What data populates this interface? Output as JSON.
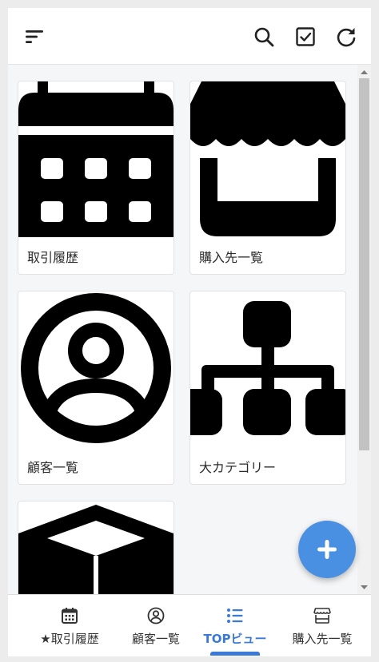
{
  "header": {
    "menu_icon": "sort-menu-icon",
    "actions": [
      "search-icon",
      "check-square-icon",
      "refresh-icon"
    ]
  },
  "cards": [
    {
      "label": "取引履歴",
      "icon": "calendar-icon"
    },
    {
      "label": "購入先一覧",
      "icon": "store-icon"
    },
    {
      "label": "顧客一覧",
      "icon": "user-circle-icon"
    },
    {
      "label": "大カテゴリー",
      "icon": "sitemap-icon"
    },
    {
      "label": "",
      "icon": "cube-icon"
    }
  ],
  "fab": {
    "icon": "plus-icon"
  },
  "bottom_nav": {
    "items": [
      {
        "label": "★取引履歴",
        "icon": "calendar-icon",
        "active": false
      },
      {
        "label": "顧客一覧",
        "icon": "user-circle-icon",
        "active": false
      },
      {
        "label": "TOPビュー",
        "icon": "list-icon",
        "active": true
      },
      {
        "label": "購入先一覧",
        "icon": "store-icon",
        "active": false
      }
    ]
  },
  "colors": {
    "accent": "#3a7ad6",
    "fab": "#4a90e2",
    "background": "#f5f6f8"
  }
}
